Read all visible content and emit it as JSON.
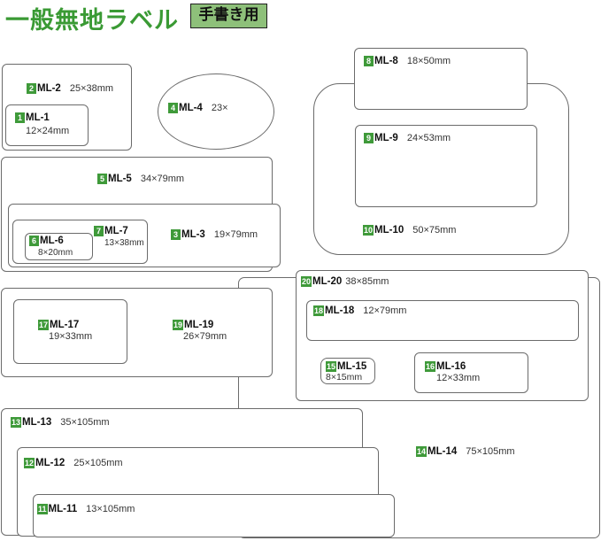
{
  "colors": {
    "accent": "#3a9a34",
    "badge_bg": "#8ec07a",
    "number_bg": "#3f9a3a"
  },
  "header": {
    "title": "一般無地ラベル",
    "badge": "手書き用"
  },
  "labels": {
    "ml1": {
      "num": "1",
      "code": "ML-1",
      "size": "12×24mm"
    },
    "ml2": {
      "num": "2",
      "code": "ML-2",
      "size": "25×38mm"
    },
    "ml3": {
      "num": "3",
      "code": "ML-3",
      "size": "19×79mm"
    },
    "ml4": {
      "num": "4",
      "code": "ML-4",
      "size": "23×"
    },
    "ml5": {
      "num": "5",
      "code": "ML-5",
      "size": "34×79mm"
    },
    "ml6": {
      "num": "6",
      "code": "ML-6",
      "size": "8×20mm"
    },
    "ml7": {
      "num": "7",
      "code": "ML-7",
      "size": "13×38mm"
    },
    "ml8": {
      "num": "8",
      "code": "ML-8",
      "size": "18×50mm"
    },
    "ml9": {
      "num": "9",
      "code": "ML-9",
      "size": "24×53mm"
    },
    "ml10": {
      "num": "10",
      "code": "ML-10",
      "size": "50×75mm"
    },
    "ml11": {
      "num": "11",
      "code": "ML-11",
      "size": "13×105mm"
    },
    "ml12": {
      "num": "12",
      "code": "ML-12",
      "size": "25×105mm"
    },
    "ml13": {
      "num": "13",
      "code": "ML-13",
      "size": "35×105mm"
    },
    "ml14": {
      "num": "14",
      "code": "ML-14",
      "size": "75×105mm"
    },
    "ml15": {
      "num": "15",
      "code": "ML-15",
      "size": "8×15mm"
    },
    "ml16": {
      "num": "16",
      "code": "ML-16",
      "size": "12×33mm"
    },
    "ml17": {
      "num": "17",
      "code": "ML-17",
      "size": "19×33mm"
    },
    "ml18": {
      "num": "18",
      "code": "ML-18",
      "size": "12×79mm"
    },
    "ml19": {
      "num": "19",
      "code": "ML-19",
      "size": "26×79mm"
    },
    "ml20": {
      "num": "20",
      "code": "ML-20",
      "size": "38×85mm"
    }
  }
}
